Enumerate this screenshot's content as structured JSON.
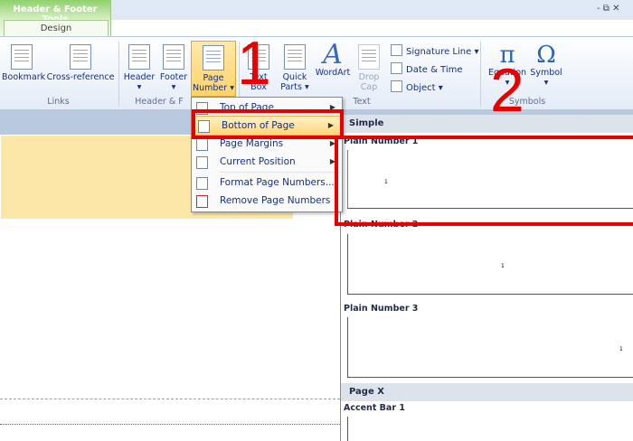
{
  "window": {
    "context_title": "Header & Footer Tools",
    "design_tab": "Design",
    "controls": "- ⧉ ✕"
  },
  "ribbon": {
    "links_group": {
      "label": "Links",
      "bookmark": "Bookmark",
      "cross_reference": "Cross-reference"
    },
    "header_footer_group": {
      "label": "Header & F",
      "header": "Header",
      "footer": "Footer",
      "page_number_line1": "Page",
      "page_number_line2": "Number"
    },
    "text_group": {
      "label": "Text",
      "text_box_line1": "Text",
      "text_box_line2": "Box",
      "quick_parts_line1": "Quick",
      "quick_parts_line2": "Parts",
      "wordart": "WordArt",
      "drop_cap_line1": "Drop",
      "drop_cap_line2": "Cap",
      "signature_line": "Signature Line",
      "date_time": "Date & Time",
      "object": "Object"
    },
    "symbols_group": {
      "label": "Symbols",
      "equation": "Equation",
      "symbol": "Symbol",
      "equation_glyph": "π",
      "symbol_glyph": "Ω"
    }
  },
  "menu": {
    "items": [
      {
        "label": "Top of Page",
        "icon": "top-of-page-icon",
        "submenu": true
      },
      {
        "label": "Bottom of Page",
        "icon": "bottom-of-page-icon",
        "submenu": true,
        "active": true
      },
      {
        "label": "Page Margins",
        "icon": "page-margins-icon",
        "submenu": true
      },
      {
        "label": "Current Position",
        "icon": "current-position-icon",
        "submenu": true
      },
      {
        "label": "Format Page Numbers...",
        "icon": "format-page-numbers-icon",
        "submenu": false
      },
      {
        "label": "Remove Page Numbers",
        "icon": "remove-page-numbers-icon",
        "submenu": false
      }
    ],
    "arrow": "▶"
  },
  "gallery": {
    "section_simple": "Simple",
    "plain_number_1": "Plain Number 1",
    "plain_number_2": "Plain Number 2",
    "plain_number_3": "Plain Number 3",
    "section_page_x": "Page X",
    "accent_bar_1": "Accent Bar 1",
    "sample_number": "1"
  },
  "annotations": {
    "step1": "1",
    "step2": "2",
    "color": "#e60000"
  },
  "colors": {
    "highlight": "#ffd67a",
    "selected_item": "#fde7a8",
    "context_tab": "#8fd06b"
  }
}
